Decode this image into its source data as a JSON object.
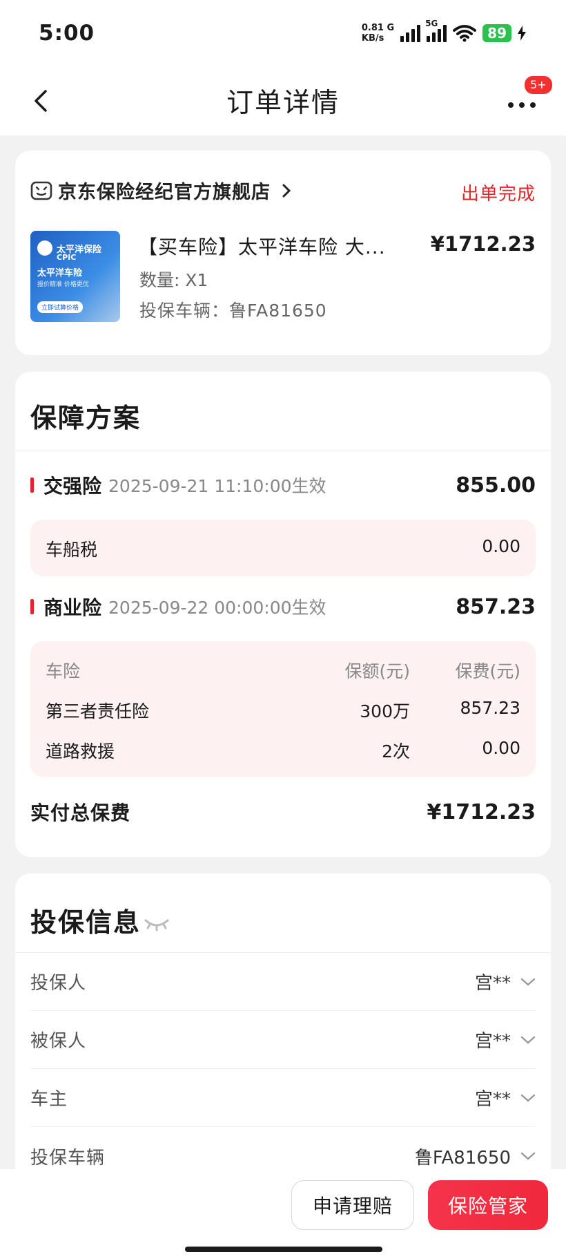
{
  "status_bar": {
    "time": "5:00",
    "net_speed_value": "0.81 G",
    "net_speed_unit": "KB/s",
    "network_type": "5G",
    "battery": "89"
  },
  "header": {
    "title": "订单详情",
    "more_badge": "5+"
  },
  "order": {
    "store_name": "京东保险经纪官方旗舰店",
    "status": "出单完成",
    "product_title": "【买车险】太平洋车险 大...",
    "price": "¥1712.23",
    "quantity": "数量: X1",
    "vehicle": "投保车辆：鲁FA81650",
    "thumb": {
      "brand": "太平洋保险",
      "brand_en": "CPIC",
      "subtitle": "太平洋车险",
      "tagline": "报价精准 价格更优",
      "cta": "立即试算价格"
    }
  },
  "coverage": {
    "title": "保障方案",
    "compulsory": {
      "name": "交强险",
      "effective": "2025-09-21 11:10:00生效",
      "amount": "855.00",
      "vessel_tax_label": "车船税",
      "vessel_tax_amount": "0.00"
    },
    "commercial": {
      "name": "商业险",
      "effective": "2025-09-22 00:00:00生效",
      "amount": "857.23",
      "table": {
        "headers": [
          "车险",
          "保额(元)",
          "保费(元)"
        ],
        "rows": [
          [
            "第三者责任险",
            "300万",
            "857.23"
          ],
          [
            "道路救援",
            "2次",
            "0.00"
          ]
        ]
      }
    },
    "total_label": "实付总保费",
    "total_amount": "¥1712.23"
  },
  "insured_info": {
    "title": "投保信息",
    "rows": [
      {
        "label": "投保人",
        "value": "宫**"
      },
      {
        "label": "被保人",
        "value": "宫**"
      },
      {
        "label": "车主",
        "value": "宫**"
      },
      {
        "label": "投保车辆",
        "value": "鲁FA81650"
      }
    ]
  },
  "bottom_bar": {
    "claim_button": "申请理赔",
    "butler_button": "保险管家"
  },
  "colors": {
    "accent_red": "#e4232a",
    "battery_green": "#2bc14c",
    "pink_panel": "#fdf1f1"
  }
}
